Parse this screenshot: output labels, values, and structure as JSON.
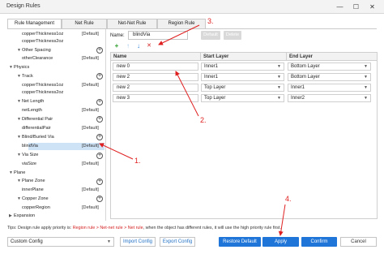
{
  "window": {
    "title": "Design Rules",
    "minimize": "—",
    "maximize": "☐",
    "close": "✕"
  },
  "tabs": [
    "Rule Management",
    "Net Rule",
    "Net-Net Rule",
    "Region Rule"
  ],
  "tree": {
    "default_tag": "[Default]",
    "rows": [
      {
        "label": "copperThickness1oz",
        "default": "[Default]"
      },
      {
        "label": "copperThickness2oz",
        "default": ""
      },
      {
        "label": "Other Spacing",
        "default": ""
      },
      {
        "label": "otherClearance",
        "default": "[Default]"
      },
      {
        "label": "Physics",
        "default": ""
      },
      {
        "label": "Track",
        "default": ""
      },
      {
        "label": "copperThickness1oz",
        "default": "[Default]"
      },
      {
        "label": "copperThickness2oz",
        "default": ""
      },
      {
        "label": "Net Length",
        "default": ""
      },
      {
        "label": "netLength",
        "default": "[Default]"
      },
      {
        "label": "Differential Pair",
        "default": ""
      },
      {
        "label": "differentialPair",
        "default": "[Default]"
      },
      {
        "label": "Blind/Buried Via",
        "default": ""
      },
      {
        "label": "blindVia",
        "default": "[Default]"
      },
      {
        "label": "Via Size",
        "default": ""
      },
      {
        "label": "viaSize",
        "default": "[Default]"
      },
      {
        "label": "Plane",
        "default": ""
      },
      {
        "label": "Plane Zone",
        "default": ""
      },
      {
        "label": "innerPlane",
        "default": "[Default]"
      },
      {
        "label": "Copper Zone",
        "default": ""
      },
      {
        "label": "copperRegion",
        "default": "[Default]"
      },
      {
        "label": "Expansion",
        "default": ""
      }
    ]
  },
  "editor": {
    "name_label": "Name:",
    "name_value": "blindVia",
    "default_button": "Default",
    "delete_button": "Delete",
    "toolbar": {
      "add": "+",
      "up": "↑",
      "down": "↓",
      "remove": "✕"
    },
    "columns": [
      "Name",
      "Start Layer",
      "End Layer"
    ],
    "rows": [
      {
        "name": "new 0",
        "start": "Inner1",
        "end": "Bottom Layer"
      },
      {
        "name": "new 2",
        "start": "Inner1",
        "end": "Bottom Layer"
      },
      {
        "name": "new 2",
        "start": "Top Layer",
        "end": "Inner1"
      },
      {
        "name": "new 3",
        "start": "Top Layer",
        "end": "Inner2"
      }
    ]
  },
  "annotations": [
    "1.",
    "2.",
    "3.",
    "4."
  ],
  "tips": {
    "prefix": "Tips: Design rule apply priority is: ",
    "priority": "Region rule > Net-net rule > Net rule",
    "suffix": ", when the object has different rules, it will use the high priority rule first."
  },
  "footer": {
    "config_value": "Custom Config",
    "import_button": "Import Config",
    "export_button": "Export Config",
    "restore_button": "Restore Default",
    "apply_button": "Apply",
    "confirm_button": "Confirm",
    "cancel_button": "Cancel"
  },
  "colors": {
    "accent": "#1f75d8",
    "annotation": "#e02020",
    "selection": "#cfe3f7"
  }
}
